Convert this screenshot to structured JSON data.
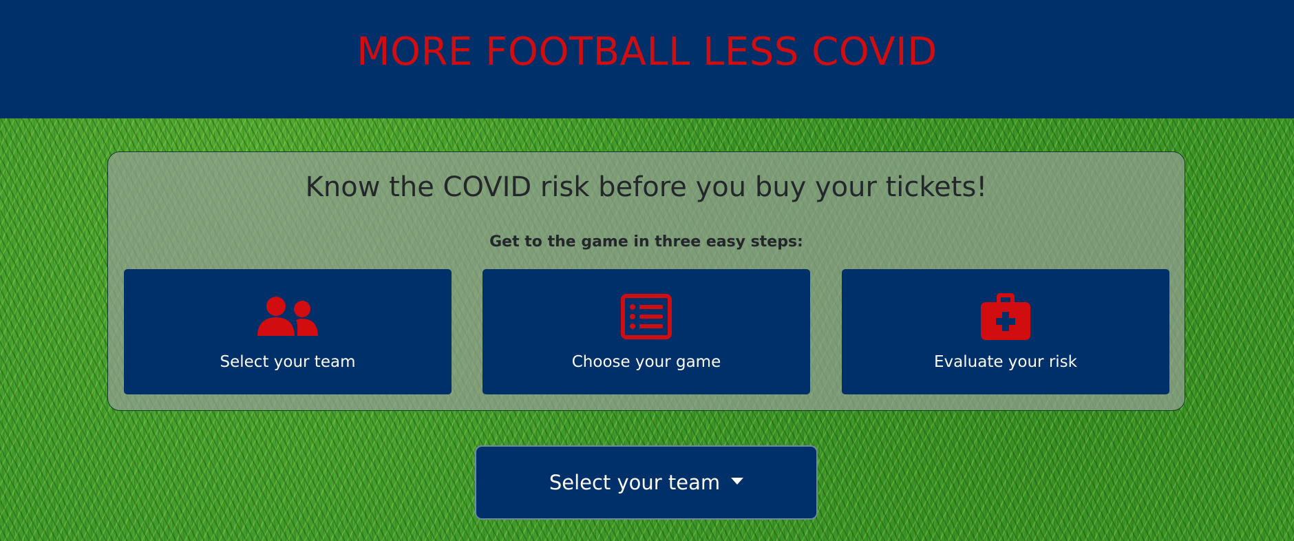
{
  "header": {
    "title": "MORE FOOTBALL LESS COVID"
  },
  "panel": {
    "headline": "Know the COVID risk before you buy your tickets!",
    "subhead": "Get to the game in three easy steps:",
    "steps": [
      {
        "label": "Select your team",
        "icon": "users-icon"
      },
      {
        "label": "Choose your game",
        "icon": "list-icon"
      },
      {
        "label": "Evaluate your risk",
        "icon": "medical-kit-icon"
      }
    ]
  },
  "team_select": {
    "label": "Select your team",
    "icon": "caret-down-icon"
  },
  "colors": {
    "navy": "#00306a",
    "accent_red": "#d10d10",
    "grass_green": "#3f9a2a"
  }
}
